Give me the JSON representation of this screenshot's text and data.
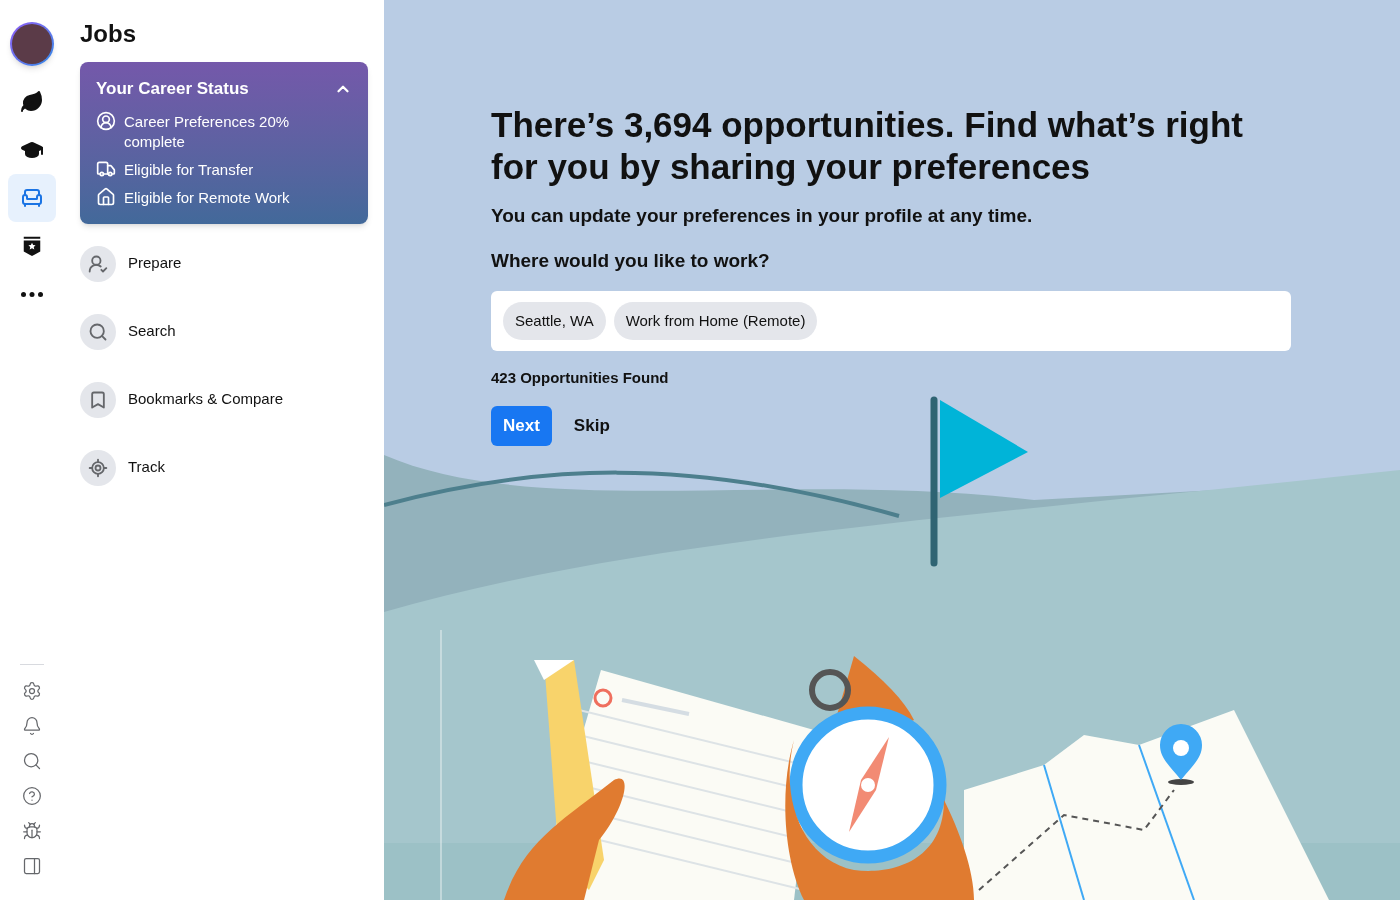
{
  "rail": {
    "items": [
      {
        "kind": "leaf",
        "selected": false
      },
      {
        "kind": "cap",
        "selected": false
      },
      {
        "kind": "chair",
        "selected": true
      },
      {
        "kind": "badge",
        "selected": false
      },
      {
        "kind": "more",
        "selected": false
      }
    ],
    "bottom": [
      {
        "kind": "settings"
      },
      {
        "kind": "bell"
      },
      {
        "kind": "search"
      },
      {
        "kind": "help"
      },
      {
        "kind": "bug"
      },
      {
        "kind": "panel"
      }
    ]
  },
  "sidebar": {
    "title": "Jobs",
    "status_card": {
      "title": "Your Career Status",
      "expanded": true,
      "items": [
        {
          "kind": "profile",
          "label": "Career Preferences 20% complete"
        },
        {
          "kind": "transfer",
          "label": "Eligible for Transfer"
        },
        {
          "kind": "remote",
          "label": "Eligible for Remote Work"
        }
      ]
    },
    "items": [
      {
        "kind": "prepare",
        "label": "Prepare"
      },
      {
        "kind": "search",
        "label": "Search"
      },
      {
        "kind": "bookmark",
        "label": "Bookmarks & Compare"
      },
      {
        "kind": "track",
        "label": "Track"
      }
    ]
  },
  "main": {
    "heading": "There’s 3,694 opportunities. Find what’s right for you by sharing your preferences",
    "subheading": "You can update your preferences in your profile at any time.",
    "question": "Where would you like to work?",
    "locations": [
      "Seattle, WA",
      "Work from Home (Remote)"
    ],
    "results": "423 Opportunities Found",
    "buttons": {
      "primary": "Next",
      "secondary": "Skip"
    }
  }
}
